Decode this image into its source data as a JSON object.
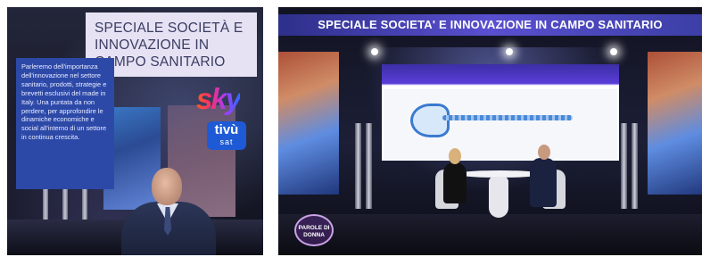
{
  "left_panel": {
    "title": "SPECIALE SOCIETÀ E INNOVAZIONE IN CAMPO SANITARIO",
    "description": "Parleremo dell'importanza dell'innovazione nel settore sanitario, prodotti, strategie e brevetti esclusivi del made in Italy. Una puntata da non perdere, per approfondire le dinamiche economiche e social all'interno di un settore in continua crescita.",
    "logos": {
      "sky": "sky",
      "tivu_line1": "tivù",
      "tivu_line2": "sat"
    }
  },
  "right_panel": {
    "banner": "SPECIALE SOCIETA' E INNOVAZIONE IN CAMPO SANITARIO",
    "show_logo": "PAROLE DI DONNA"
  },
  "colors": {
    "title_box_bg": "#e6e2f4",
    "description_bg": "#2d49a8",
    "banner_bg": "#5a4fd0"
  }
}
